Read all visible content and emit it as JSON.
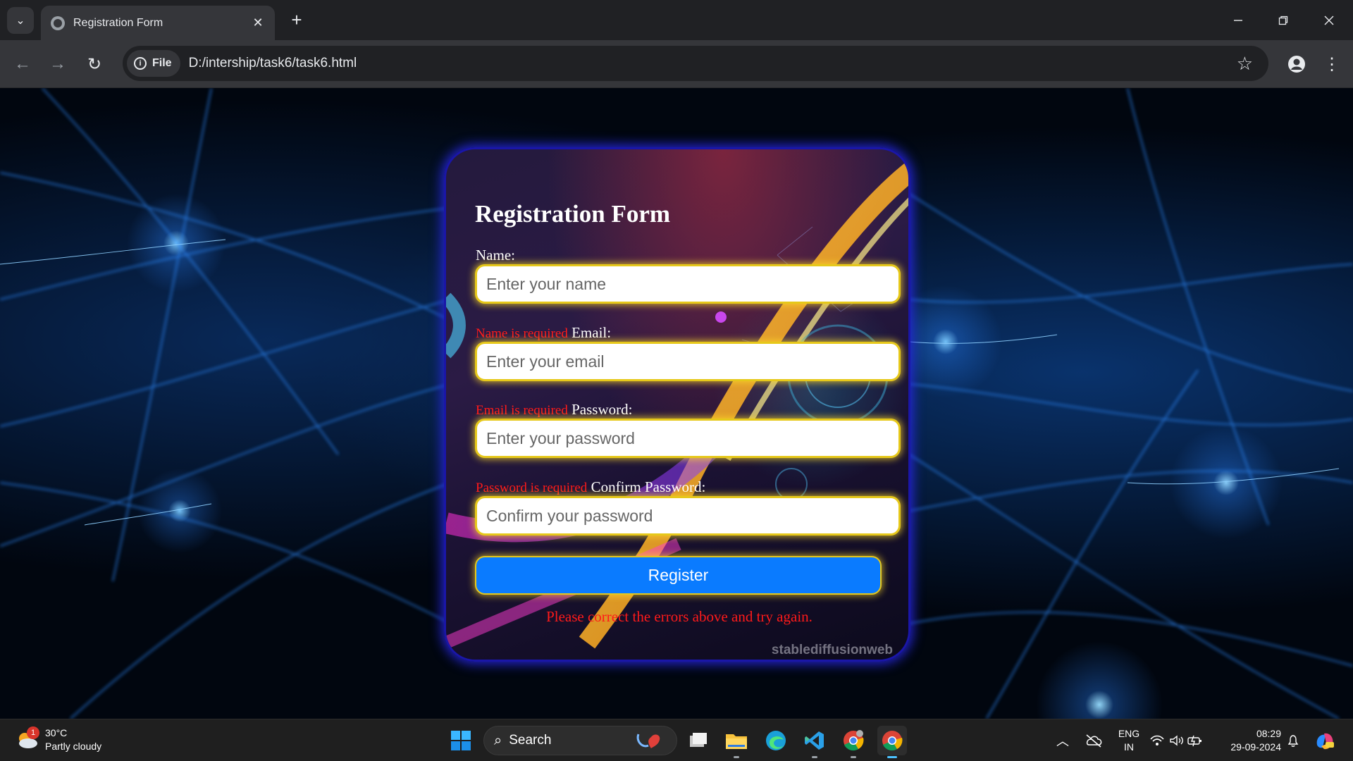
{
  "browser": {
    "tab_title": "Registration Form",
    "tab_close": "✕",
    "new_tab": "+",
    "site_chip_label": "File",
    "url": "D:/intership/task6/task6.html"
  },
  "form": {
    "title": "Registration Form",
    "name_label": "Name:",
    "name_placeholder": "Enter your name",
    "name_error": "Name is required",
    "email_label": "Email:",
    "email_placeholder": "Enter your email",
    "email_error": "Email is required",
    "password_label": "Password:",
    "password_placeholder": "Enter your password",
    "password_error": "Password is required",
    "confirm_label": "Confirm Password:",
    "confirm_placeholder": "Confirm your password",
    "register_label": "Register",
    "form_error": "Please correct the errors above and try again.",
    "watermark": "stablediffusionweb"
  },
  "taskbar": {
    "weather_temp": "30°C",
    "weather_desc": "Partly cloudy",
    "weather_badge": "1",
    "search_label": "Search",
    "lang_top": "ENG",
    "lang_bottom": "IN",
    "time": "08:29",
    "date": "29-09-2024"
  },
  "colors": {
    "tab_bar": "#202124",
    "toolbar": "#35363a",
    "card_border": "#1a16a8",
    "field_border": "#e6c81a",
    "button": "#0a7bff",
    "error_text": "#ff1a1a"
  }
}
